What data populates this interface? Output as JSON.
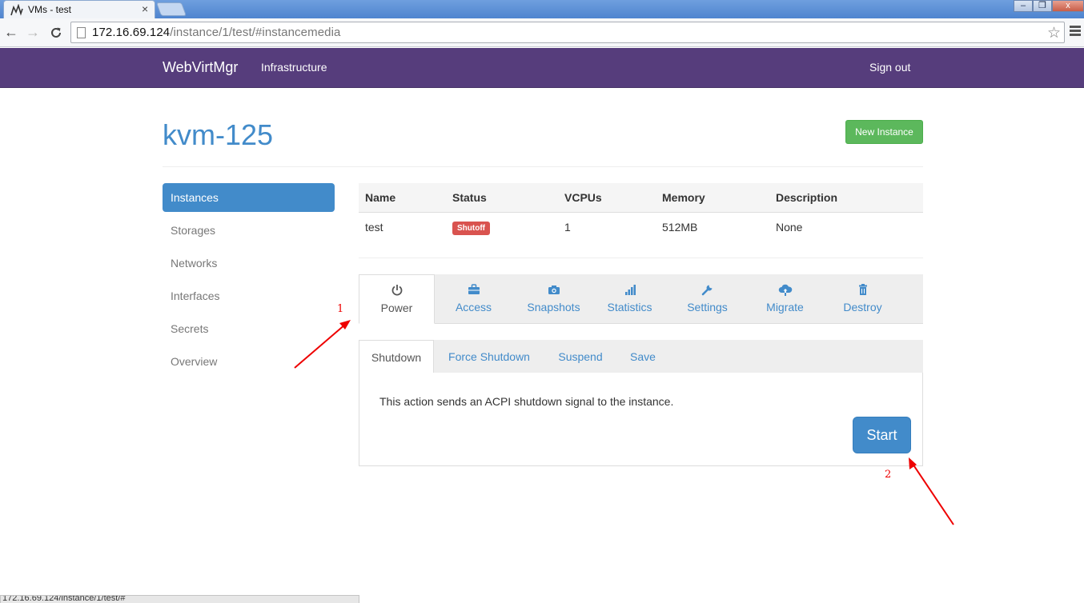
{
  "browser": {
    "tab_title": "VMs - test",
    "tab_close": "×",
    "window_controls": {
      "minimize": "–",
      "maximize": "❐",
      "close": "x"
    },
    "url_host": "172.16.69.124",
    "url_path": "/instance/1/test/#instancemedia",
    "status_url": "172.16.69.124/instance/1/test/#"
  },
  "navbar": {
    "brand": "WebVirtMgr",
    "infrastructure": "Infrastructure",
    "sign_out": "Sign out",
    "color": "#563d7c"
  },
  "header": {
    "title": "kvm-125",
    "new_instance": "New Instance"
  },
  "sidebar": {
    "items": [
      {
        "label": "Instances",
        "active": true
      },
      {
        "label": "Storages"
      },
      {
        "label": "Networks"
      },
      {
        "label": "Interfaces"
      },
      {
        "label": "Secrets"
      },
      {
        "label": "Overview"
      }
    ]
  },
  "table": {
    "columns": [
      "Name",
      "Status",
      "VCPUs",
      "Memory",
      "Description"
    ],
    "rows": [
      {
        "name": "test",
        "status": "Shutoff",
        "vcpus": "1",
        "memory": "512MB",
        "description": "None"
      }
    ]
  },
  "action_tabs": [
    {
      "label": "Power",
      "icon": "power-icon",
      "active": true
    },
    {
      "label": "Access",
      "icon": "briefcase-icon"
    },
    {
      "label": "Snapshots",
      "icon": "camera-icon"
    },
    {
      "label": "Statistics",
      "icon": "signal-bars-icon"
    },
    {
      "label": "Settings",
      "icon": "wrench-icon"
    },
    {
      "label": "Migrate",
      "icon": "cloud-upload-icon"
    },
    {
      "label": "Destroy",
      "icon": "trash-icon"
    }
  ],
  "sub_tabs": [
    {
      "label": "Shutdown",
      "active": true
    },
    {
      "label": "Force Shutdown"
    },
    {
      "label": "Suspend"
    },
    {
      "label": "Save"
    }
  ],
  "panel": {
    "text": "This action sends an ACPI shutdown signal to the instance.",
    "start_button": "Start"
  },
  "annotations": [
    "1",
    "2"
  ],
  "colors": {
    "primary": "#428bca",
    "success": "#5cb85c",
    "danger": "#d9534f",
    "annotation": "#e00000"
  }
}
